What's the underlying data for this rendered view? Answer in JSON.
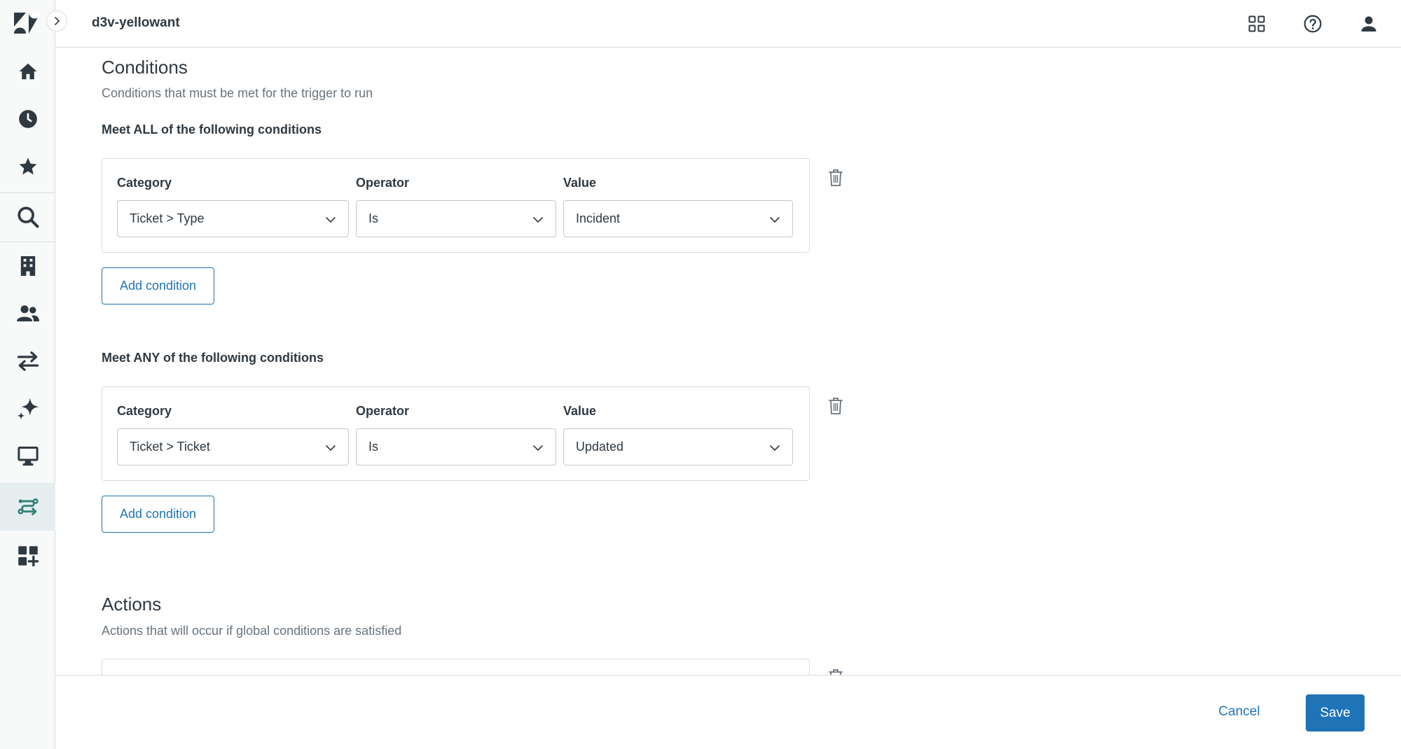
{
  "header": {
    "account_name": "d3v-yellowant"
  },
  "icons": {
    "logo": "zendesk-logo",
    "nav": [
      "home-icon",
      "clock-icon",
      "star-icon",
      "search-icon",
      "building-icon",
      "people-icon",
      "arrows-icon",
      "sparkle-icon",
      "monitor-icon",
      "workflow-icon",
      "apps-add-icon"
    ],
    "top": [
      "grid-icon",
      "help-icon",
      "user-icon"
    ]
  },
  "conditions": {
    "title": "Conditions",
    "subtitle": "Conditions that must be met for the trigger to run",
    "all_group": {
      "title": "Meet ALL of the following conditions",
      "category_label": "Category",
      "operator_label": "Operator",
      "value_label": "Value",
      "category": "Ticket > Type",
      "operator": "Is",
      "value": "Incident",
      "add_label": "Add condition"
    },
    "any_group": {
      "title": "Meet ANY of the following conditions",
      "category_label": "Category",
      "operator_label": "Operator",
      "value_label": "Value",
      "category": "Ticket > Ticket",
      "operator": "Is",
      "value": "Updated",
      "add_label": "Add condition"
    }
  },
  "actions": {
    "title": "Actions",
    "subtitle": "Actions that will occur if global conditions are satisfied"
  },
  "footer": {
    "cancel_label": "Cancel",
    "save_label": "Save"
  },
  "colors": {
    "accent": "#1f73b7",
    "rail_bg": "#f8f9f9",
    "active_bg": "#e6eef0",
    "icon": "#2f3941"
  }
}
